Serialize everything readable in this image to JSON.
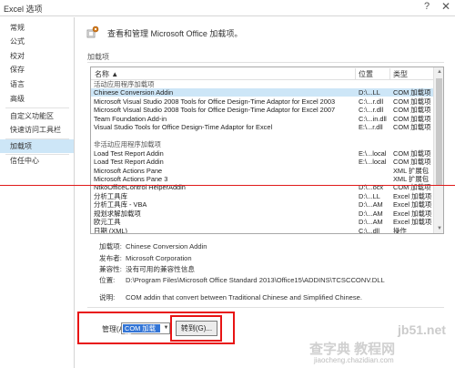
{
  "window": {
    "title": "Excel 选项",
    "help": "?",
    "close": "✕"
  },
  "sidebar": {
    "items": [
      {
        "label": "常规",
        "active": false
      },
      {
        "label": "公式",
        "active": false
      },
      {
        "label": "校对",
        "active": false
      },
      {
        "label": "保存",
        "active": false
      },
      {
        "label": "语言",
        "active": false
      },
      {
        "label": "高级",
        "active": false
      },
      {
        "label": "自定义功能区",
        "active": false
      },
      {
        "label": "快速访问工具栏",
        "active": false
      },
      {
        "label": "加载项",
        "active": true
      },
      {
        "label": "信任中心",
        "active": false
      }
    ]
  },
  "header": {
    "text": "查看和管理 Microsoft Office 加载项。",
    "icon": "addin-gear-icon"
  },
  "section": {
    "label": "加载项"
  },
  "list": {
    "columns": [
      "名称 ▲",
      "位置",
      "类型"
    ],
    "rows": [
      {
        "kind": "group",
        "name": "活动应用程序加载项",
        "loc": "",
        "type": ""
      },
      {
        "kind": "item",
        "selected": true,
        "name": "Chinese Conversion Addin",
        "loc": "D:\\...LL",
        "type": "COM 加载项"
      },
      {
        "kind": "item",
        "name": "Microsoft Visual Studio 2008 Tools for Office Design-Time Adaptor for Excel 2003",
        "loc": "C:\\...r.dll",
        "type": "COM 加载项"
      },
      {
        "kind": "item",
        "name": "Microsoft Visual Studio 2008 Tools for Office Design-Time Adaptor for Excel 2007",
        "loc": "C:\\...r.dll",
        "type": "COM 加载项"
      },
      {
        "kind": "item",
        "name": "Team Foundation Add-in",
        "loc": "C:\\...in.dll",
        "type": "COM 加载项"
      },
      {
        "kind": "item",
        "name": "Visual Studio Tools for Office Design-Time Adaptor for Excel",
        "loc": "E:\\...r.dll",
        "type": "COM 加载项"
      },
      {
        "kind": "gap",
        "name": "",
        "loc": "",
        "type": ""
      },
      {
        "kind": "group",
        "name": "非活动应用程序加载项",
        "loc": "",
        "type": ""
      },
      {
        "kind": "item",
        "name": "Load Test Report Addin",
        "loc": "E:\\...local",
        "type": "COM 加载项"
      },
      {
        "kind": "item",
        "name": "Load Test Report Addin",
        "loc": "E:\\...local",
        "type": "COM 加载项"
      },
      {
        "kind": "item",
        "name": "Microsoft Actions Pane",
        "loc": "",
        "type": "XML 扩展包"
      },
      {
        "kind": "item",
        "name": "Microsoft Actions Pane 3",
        "loc": "",
        "type": "XML 扩展包"
      },
      {
        "kind": "item",
        "name": "NtkoOfficeControl HelperAddin",
        "loc": "D:\\...ocx",
        "type": "COM 加载项"
      },
      {
        "kind": "item",
        "name": "分析工具库",
        "loc": "D:\\...LL",
        "type": "Excel 加载项"
      },
      {
        "kind": "item",
        "name": "分析工具库 - VBA",
        "loc": "D:\\...AM",
        "type": "Excel 加载项"
      },
      {
        "kind": "item",
        "name": "规划求解加载项",
        "loc": "D:\\...AM",
        "type": "Excel 加载项"
      },
      {
        "kind": "item",
        "name": "欧元工具",
        "loc": "D:\\...AM",
        "type": "Excel 加载项"
      },
      {
        "kind": "item",
        "name": "日期 (XML)",
        "loc": "C:\\...dll",
        "type": "操作"
      }
    ]
  },
  "details": {
    "addin": {
      "key": "加载项:",
      "value": "Chinese Conversion Addin"
    },
    "publisher": {
      "key": "发布者:",
      "value": "Microsoft Corporation"
    },
    "compat": {
      "key": "兼容性:",
      "value": "没有可用的兼容性信息"
    },
    "location": {
      "key": "位置:",
      "value": "D:\\Program Files\\Microsoft Office Standard 2013\\Office15\\ADDINS\\TCSCCONV.DLL"
    },
    "desc": {
      "key": "说明:",
      "value": "COM addin that convert between Traditional Chinese and Simplified Chinese."
    }
  },
  "manage": {
    "label": "管理(A):",
    "selected": "COM 加载项",
    "go": "转到(G)..."
  },
  "colors": {
    "accent": "#cde6f7",
    "highlight": "#e81414",
    "select": "#3375d6"
  },
  "watermarks": {
    "w1": "jb51.net",
    "w2": "查字典 教程网",
    "w3": "jiaocheng.chazidian.com"
  }
}
